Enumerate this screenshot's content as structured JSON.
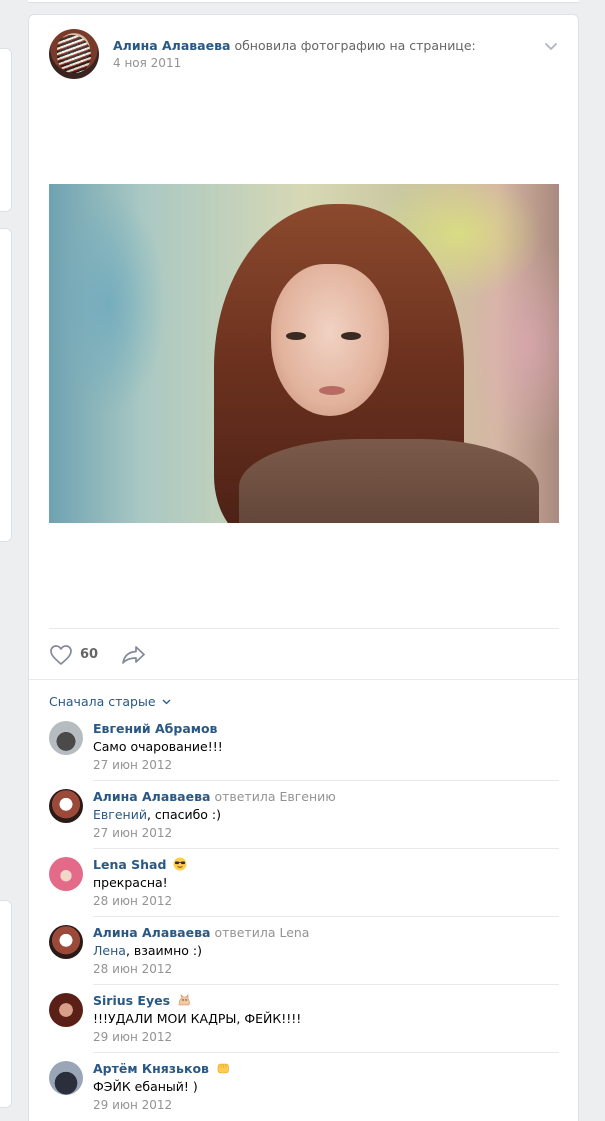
{
  "post": {
    "author_name": "Алина Алаваева",
    "author_action": "обновила фотографию на странице:",
    "date": "4 ноя 2011",
    "likes": "60",
    "icons": {
      "menu": "chevron-down-icon",
      "like": "heart-icon",
      "share": "share-arrow-icon"
    }
  },
  "comments_sort": "Сначала старые",
  "comments": [
    {
      "author": "Евгений Абрамов",
      "reply_to": "",
      "mention": "",
      "text": "Само очарование!!!",
      "date": "27 июн 2012"
    },
    {
      "author": "Алина Алаваева",
      "reply_to": "ответила Евгению",
      "mention": "Евгений",
      "text": ", спасибо :)",
      "date": "27 июн 2012"
    },
    {
      "author": "Lena Shad",
      "reply_to": "",
      "mention": "",
      "text": "прекрасна!",
      "date": "28 июн 2012",
      "emoji": "sunglasses-emoji"
    },
    {
      "author": "Алина Алаваева",
      "reply_to": "ответила Lena",
      "mention": "Лена",
      "text": ", взаимно :)",
      "date": "28 июн 2012"
    },
    {
      "author": "Sirius Eyes",
      "reply_to": "",
      "mention": "",
      "text": "!!!УДАЛИ МОИ КАДРЫ, ФЕЙК!!!!",
      "date": "29 июн 2012",
      "emoji": "cat-emoji"
    },
    {
      "author": "Артём Князьков",
      "reply_to": "",
      "mention": "",
      "text": "ФЭЙК ебаный! )",
      "date": "29 июн 2012",
      "emoji": "fist-emoji"
    }
  ],
  "colors": {
    "link": "#2a5885",
    "muted": "#939393",
    "background": "#edeef0"
  }
}
